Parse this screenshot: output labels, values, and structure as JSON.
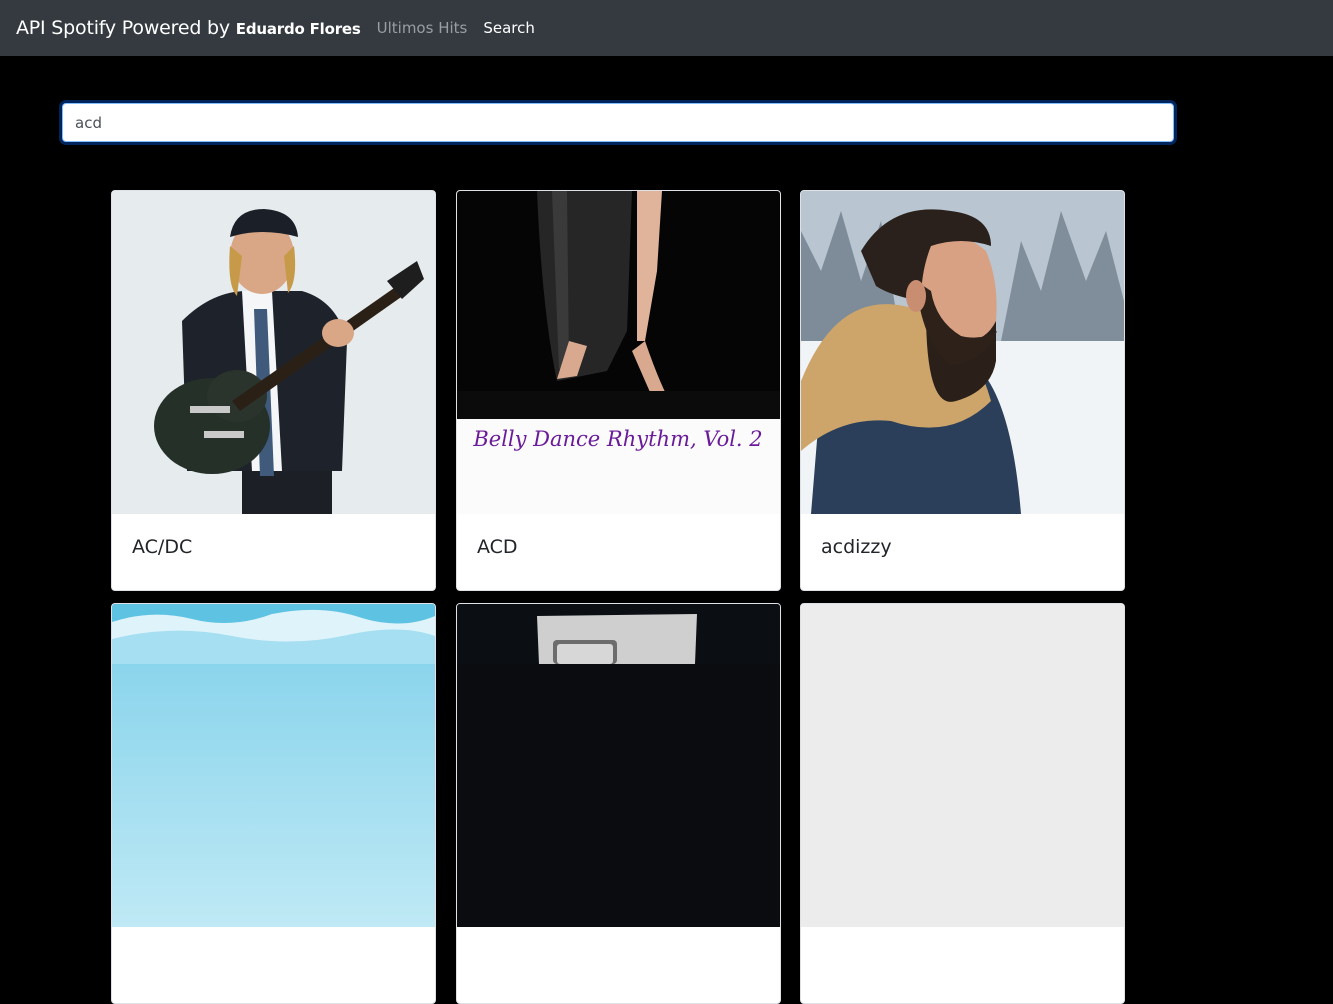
{
  "navbar": {
    "brand_prefix": "API Spotify Powered by",
    "brand_author": "Eduardo Flores",
    "links": [
      {
        "label": "Ultimos Hits",
        "state": "inactive"
      },
      {
        "label": "Search",
        "state": "active"
      }
    ]
  },
  "search": {
    "value": "acd",
    "focus_color": "#80bdff"
  },
  "results": [
    {
      "name": "AC/DC",
      "image": "artist-photo-guitarist"
    },
    {
      "name": "ACD",
      "image": "album-cover-belly-dance",
      "cover_text": "Belly Dance Rhythm, Vol. 2"
    },
    {
      "name": "acdizzy",
      "image": "artist-photo-bearded-man"
    },
    {
      "name": "",
      "image": "sky-cover"
    },
    {
      "name": "",
      "image": "turntable-cover"
    },
    {
      "name": "",
      "image": "blank-cover"
    }
  ],
  "colors": {
    "navbar_bg": "#343a40",
    "page_bg": "#000000",
    "card_bg": "#ffffff",
    "cover_text": "#6a1b9a"
  }
}
